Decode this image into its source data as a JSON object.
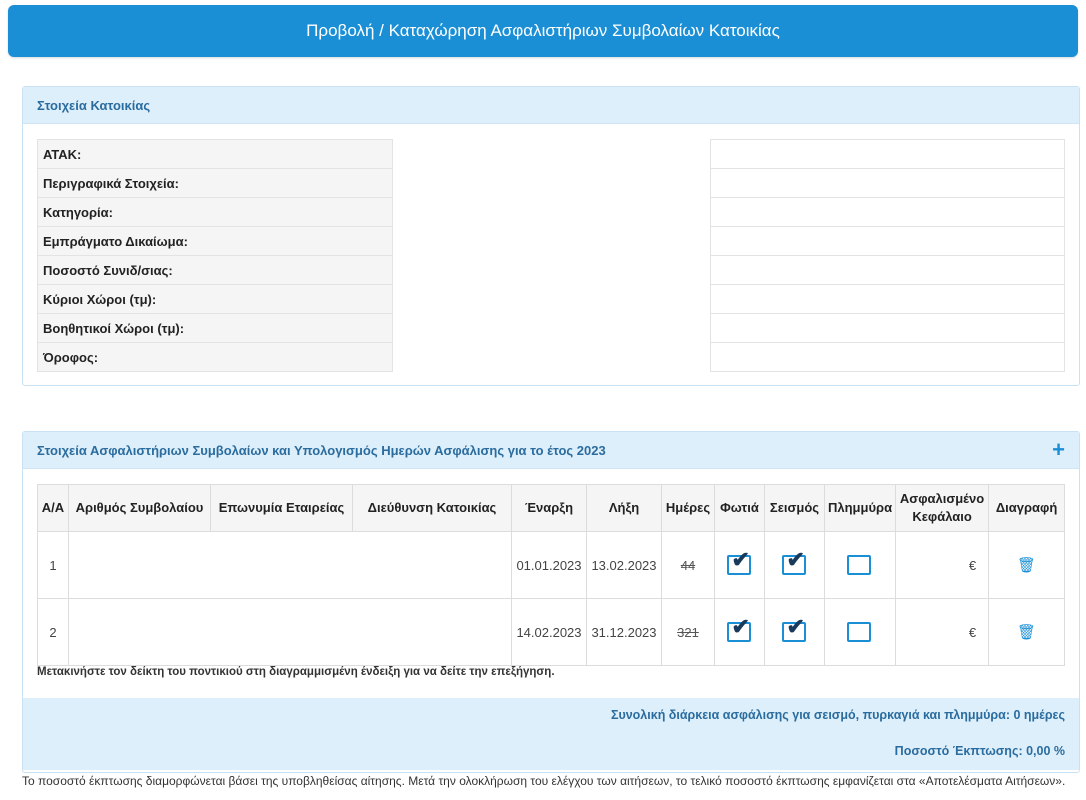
{
  "header": {
    "title": "Προβολή / Καταχώρηση Ασφαλιστήριων Συμβολαίων Κατοικίας"
  },
  "residence": {
    "title": "Στοιχεία Κατοικίας",
    "fields": [
      {
        "label": "ΑΤΑΚ:"
      },
      {
        "label": "Περιγραφικά Στοιχεία:"
      },
      {
        "label": "Κατηγορία:"
      },
      {
        "label": "Εμπράγματο Δικαίωμα:"
      },
      {
        "label": "Ποσοστό Συνιδ/σιας:"
      },
      {
        "label": "Κύριοι Χώροι (τμ):"
      },
      {
        "label": "Βοηθητικοί Χώροι (τμ):"
      },
      {
        "label": "Όροφος:"
      }
    ]
  },
  "policies": {
    "title": "Στοιχεία Ασφαλιστήριων Συμβολαίων και Υπολογισμός Ημερών Ασφάλισης για το έτος 2023",
    "add_icon": "+",
    "columns": {
      "aa": "Α/Α",
      "policy_no": "Αριθμός Συμβολαίου",
      "company": "Επωνυμία Εταιρείας",
      "address": "Διεύθυνση Κατοικίας",
      "start": "Έναρξη",
      "end": "Λήξη",
      "days": "Ημέρες",
      "fire": "Φωτιά",
      "earthquake": "Σεισμός",
      "flood": "Πλημμύρα",
      "capital": "Ασφαλισμένο Κεφάλαιο",
      "delete": "Διαγραφή"
    },
    "rows": [
      {
        "aa": "1",
        "start": "01.01.2023",
        "end": "13.02.2023",
        "days": "44",
        "fire": true,
        "earthquake": true,
        "flood": false,
        "capital": "€"
      },
      {
        "aa": "2",
        "start": "14.02.2023",
        "end": "31.12.2023",
        "days": "321",
        "fire": true,
        "earthquake": true,
        "flood": false,
        "capital": "€"
      }
    ],
    "hint": "Μετακινήστε τον δείκτη του ποντικιού στη διαγραμμισμένη ένδειξη για να δείτε την επεξήγηση.",
    "total_duration": "Συνολική διάρκεια ασφάλισης για σεισμό, πυρκαγιά και πλημμύρα: 0 ημέρες",
    "discount": "Ποσοστό Έκπτωσης: 0,00 %"
  },
  "footer": {
    "text": "Το ποσοστό έκπτωσης διαμορφώνεται βάσει της υποβληθείσας αίτησης. Μετά την ολοκλήρωση του ελέγχου των αιτήσεων, το τελικό ποσοστό έκπτωσης εμφανίζεται στα «Αποτελέσματα Αιτήσεων»."
  },
  "icons": {
    "checkbox_checked": "check-icon",
    "delete": "trash-icon"
  },
  "colors": {
    "accent": "#1a8fd6",
    "panel_header_bg": "#ddeffb",
    "panel_title": "#2b6c9e"
  }
}
